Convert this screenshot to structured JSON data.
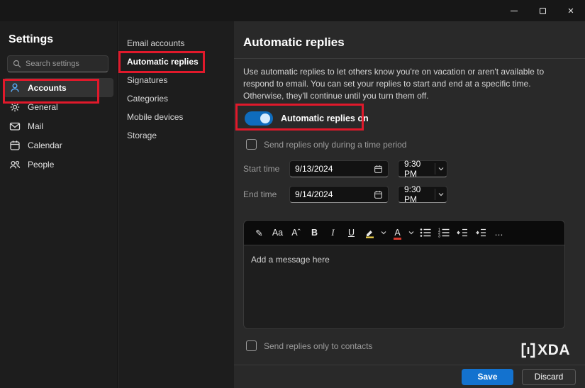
{
  "window": {
    "controls": {
      "minimize": "minimize",
      "maximize": "maximize",
      "close_glyph": "✕"
    }
  },
  "sidebar": {
    "title": "Settings",
    "search_placeholder": "Search settings",
    "items": [
      {
        "label": "Accounts",
        "icon": "person-icon",
        "selected": true
      },
      {
        "label": "General",
        "icon": "gear-icon",
        "selected": false
      },
      {
        "label": "Mail",
        "icon": "mail-icon",
        "selected": false
      },
      {
        "label": "Calendar",
        "icon": "calendar-icon",
        "selected": false
      },
      {
        "label": "People",
        "icon": "people-icon",
        "selected": false
      }
    ]
  },
  "subnav": {
    "items": [
      "Email accounts",
      "Automatic replies",
      "Signatures",
      "Categories",
      "Mobile devices",
      "Storage"
    ],
    "selected": "Automatic replies"
  },
  "main": {
    "title": "Automatic replies",
    "description": "Use automatic replies to let others know you're on vacation or aren't available to respond to email. You can set your replies to start and end at a specific time. Otherwise, they'll continue until you turn them off.",
    "toggle": {
      "label": "Automatic replies on",
      "state": "on"
    },
    "time_period_checkbox": {
      "label": "Send replies only during a time period",
      "checked": false
    },
    "start": {
      "label": "Start time",
      "date": "9/13/2024",
      "time": "9:30 PM"
    },
    "end": {
      "label": "End time",
      "date": "9/14/2024",
      "time": "9:30 PM"
    },
    "editor": {
      "placeholder": "Add a message here",
      "toolbar": [
        {
          "name": "format-painter",
          "glyph": "✎"
        },
        {
          "name": "font",
          "glyph": "Aa"
        },
        {
          "name": "font-size",
          "glyph": "Aˆ"
        },
        {
          "name": "bold",
          "glyph": "B"
        },
        {
          "name": "italic",
          "glyph": "I"
        },
        {
          "name": "underline",
          "glyph": "U"
        },
        {
          "name": "text-highlight-color"
        },
        {
          "name": "font-color",
          "glyph": "A"
        },
        {
          "name": "bullet-list"
        },
        {
          "name": "numbered-list"
        },
        {
          "name": "decrease-indent"
        },
        {
          "name": "increase-indent"
        },
        {
          "name": "more-formatting-options",
          "glyph": "…"
        }
      ]
    },
    "contacts_checkbox": {
      "label": "Send replies only to contacts",
      "checked": false
    },
    "footer": {
      "save_label": "Save",
      "discard_label": "Discard"
    }
  },
  "watermark": {
    "text": "XDA"
  },
  "annotations": [
    "accounts-nav-highlight",
    "automatic-replies-nav-highlight",
    "automatic-replies-toggle-highlight"
  ],
  "colors": {
    "accent": "#0f6cbd",
    "save_button": "#1372cf",
    "annotation_red": "#e0192b",
    "toggle_on": "#0f6cbd"
  }
}
